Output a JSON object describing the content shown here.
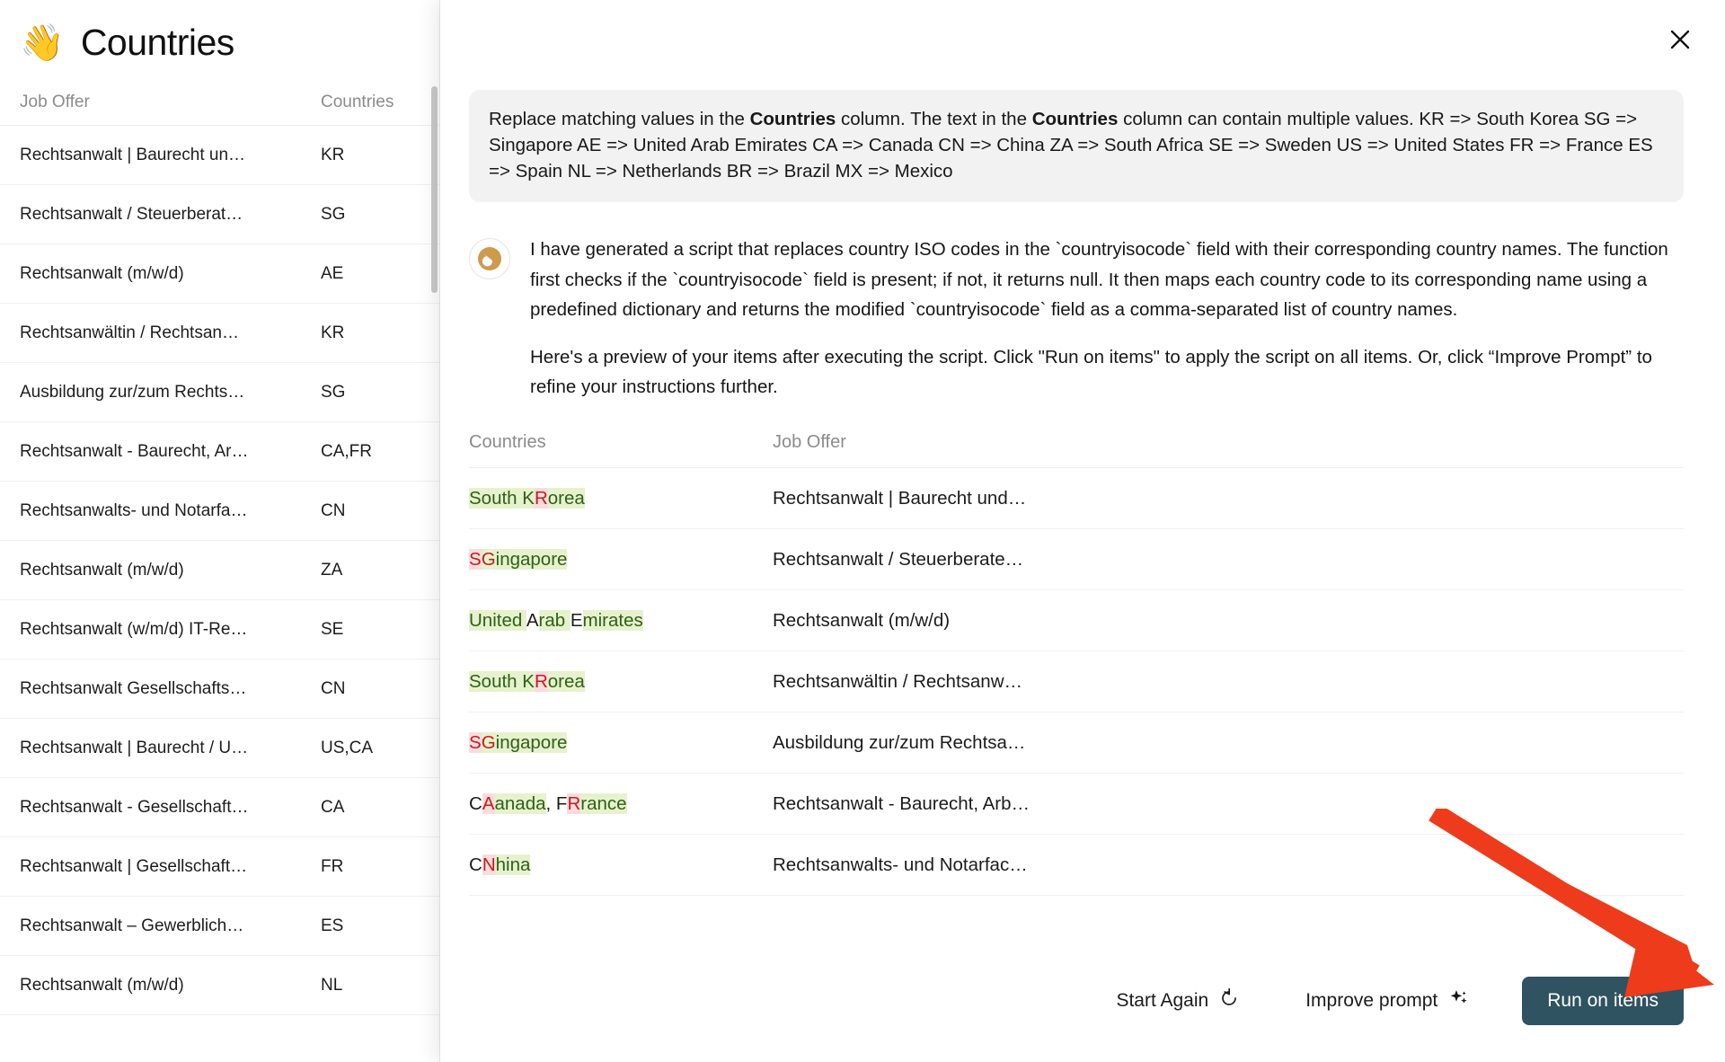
{
  "sidebar": {
    "emoji": "👋",
    "title": "Countries",
    "columns": {
      "job_offer": "Job Offer",
      "countries": "Countries"
    },
    "rows": [
      {
        "job_offer": "Rechtsanwalt | Baurecht un…",
        "countries": "KR"
      },
      {
        "job_offer": "Rechtsanwalt / Steuerberat…",
        "countries": "SG"
      },
      {
        "job_offer": "Rechtsanwalt (m/w/d)",
        "countries": "AE"
      },
      {
        "job_offer": "Rechtsanwältin / Rechtsan…",
        "countries": "KR"
      },
      {
        "job_offer": "Ausbildung zur/zum Rechts…",
        "countries": "SG"
      },
      {
        "job_offer": "Rechtsanwalt - Baurecht, Ar…",
        "countries": "CA,FR"
      },
      {
        "job_offer": "Rechtsanwalts- und Notarfa…",
        "countries": "CN"
      },
      {
        "job_offer": "Rechtsanwalt (m/w/d)",
        "countries": "ZA"
      },
      {
        "job_offer": "Rechtsanwalt (w/m/d) IT-Re…",
        "countries": "SE"
      },
      {
        "job_offer": "Rechtsanwalt Gesellschafts…",
        "countries": "CN"
      },
      {
        "job_offer": "Rechtsanwalt | Baurecht / U…",
        "countries": "US,CA"
      },
      {
        "job_offer": "Rechtsanwalt - Gesellschaft…",
        "countries": "CA"
      },
      {
        "job_offer": "Rechtsanwalt | Gesellschaft…",
        "countries": "FR"
      },
      {
        "job_offer": "Rechtsanwalt – Gewerblich…",
        "countries": "ES"
      },
      {
        "job_offer": "Rechtsanwalt (m/w/d)",
        "countries": "NL"
      }
    ]
  },
  "panel": {
    "close_icon": "close-icon",
    "prompt": {
      "segments": [
        {
          "text": "Replace matching values in the ",
          "bold": false
        },
        {
          "text": "Countries",
          "bold": true
        },
        {
          "text": " column. The text in the ",
          "bold": false
        },
        {
          "text": "Countries",
          "bold": true
        },
        {
          "text": " column can contain multiple values. KR => South Korea SG => Singapore AE => United Arab Emirates CA => Canada CN => China ZA => South Africa SE => Sweden US => United States FR => France ES => Spain NL => Netherlands BR => Brazil MX => Mexico",
          "bold": false
        }
      ]
    },
    "assistant": {
      "avatar_icon": "assistant-logo-icon",
      "paragraph_1": "I have generated a script that replaces country ISO codes in the `countryisocode` field with their corresponding country names. The function first checks if the `countryisocode` field is present; if not, it returns null. It then maps each country code to its corresponding name using a predefined dictionary and returns the modified `countryisocode` field as a comma-separated list of country names.",
      "paragraph_2": "Here's a preview of your items after executing the script. Click \"Run on items\" to apply the script on all items. Or, click “Improve Prompt” to refine your instructions further."
    },
    "preview": {
      "columns": {
        "countries": "Countries",
        "job_offer": "Job Offer"
      },
      "rows": [
        {
          "countries_diff": [
            {
              "t": "South K",
              "k": "ins"
            },
            {
              "t": "R",
              "k": "del"
            },
            {
              "t": "orea",
              "k": "ins"
            }
          ],
          "job_offer": "Rechtsanwalt | Baurecht und…"
        },
        {
          "countries_diff": [
            {
              "t": "S",
              "k": "del"
            },
            {
              "t": "G",
              "k": "del2"
            },
            {
              "t": "ingapore",
              "k": "ins"
            }
          ],
          "job_offer": "Rechtsanwalt / Steuerberate…"
        },
        {
          "countries_diff": [
            {
              "t": "United ",
              "k": "ins"
            },
            {
              "t": "A",
              "k": "plain"
            },
            {
              "t": "rab ",
              "k": "ins"
            },
            {
              "t": "E",
              "k": "plain"
            },
            {
              "t": "mirates",
              "k": "ins"
            }
          ],
          "job_offer": "Rechtsanwalt (m/w/d)"
        },
        {
          "countries_diff": [
            {
              "t": "South K",
              "k": "ins"
            },
            {
              "t": "R",
              "k": "del"
            },
            {
              "t": "orea",
              "k": "ins"
            }
          ],
          "job_offer": "Rechtsanwältin / Rechtsanw…"
        },
        {
          "countries_diff": [
            {
              "t": "S",
              "k": "del"
            },
            {
              "t": "G",
              "k": "del2"
            },
            {
              "t": "ingapore",
              "k": "ins"
            }
          ],
          "job_offer": "Ausbildung zur/zum Rechtsa…"
        },
        {
          "countries_diff": [
            {
              "t": "C",
              "k": "plain"
            },
            {
              "t": "A",
              "k": "del"
            },
            {
              "t": "anada",
              "k": "ins"
            },
            {
              "t": ", ",
              "k": "plain"
            },
            {
              "t": "F",
              "k": "plain"
            },
            {
              "t": "R",
              "k": "del"
            },
            {
              "t": "rance",
              "k": "ins"
            }
          ],
          "job_offer": "Rechtsanwalt - Baurecht, Arb…"
        },
        {
          "countries_diff": [
            {
              "t": "C",
              "k": "plain"
            },
            {
              "t": "N",
              "k": "del"
            },
            {
              "t": "hina",
              "k": "ins"
            }
          ],
          "job_offer": "Rechtsanwalts- und Notarfac…"
        }
      ]
    },
    "footer": {
      "start_again": "Start Again",
      "start_again_icon": "refresh-icon",
      "improve_prompt": "Improve prompt",
      "improve_prompt_icon": "sparkles-icon",
      "run_on_items": "Run on items"
    }
  },
  "annotation": {
    "arrow_icon": "red-arrow-pointer",
    "arrow_color": "#EE3B1B"
  },
  "colors": {
    "primary_button": "#2F5360",
    "insert_highlight": "#E6F2CD",
    "insert_text": "#2F6017",
    "delete_highlight": "#FADCDC",
    "delete_text": "#C0201F",
    "prompt_background": "#F2F2F2",
    "avatar_gold": "#CE9A4B"
  }
}
